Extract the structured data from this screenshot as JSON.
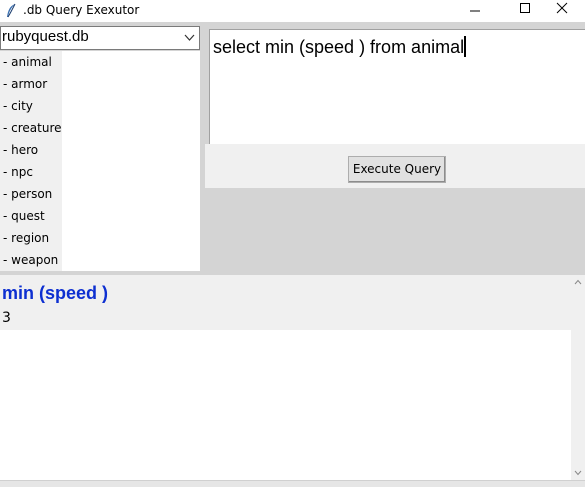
{
  "window": {
    "title": ".db Query Exexutor",
    "controls": [
      "minimize-icon",
      "maximize-icon",
      "close-icon"
    ]
  },
  "database_select": {
    "selected": "rubyquest.db",
    "icon": "chevron-down-icon"
  },
  "tables": [
    "- animal",
    "- armor",
    "- city",
    "- creature",
    "- hero",
    "- npc",
    "- person",
    "- quest",
    "- region",
    "- weapon"
  ],
  "query": {
    "text": "select min (speed ) from animal"
  },
  "execute_button": {
    "label": "Execute Query"
  },
  "results": {
    "columns": [
      "min (speed )"
    ],
    "rows": [
      [
        "3"
      ]
    ]
  },
  "colors": {
    "header_blue": "#0d2fd1",
    "panel_gray": "#d4d4d4",
    "light_gray": "#f0f0f0"
  }
}
